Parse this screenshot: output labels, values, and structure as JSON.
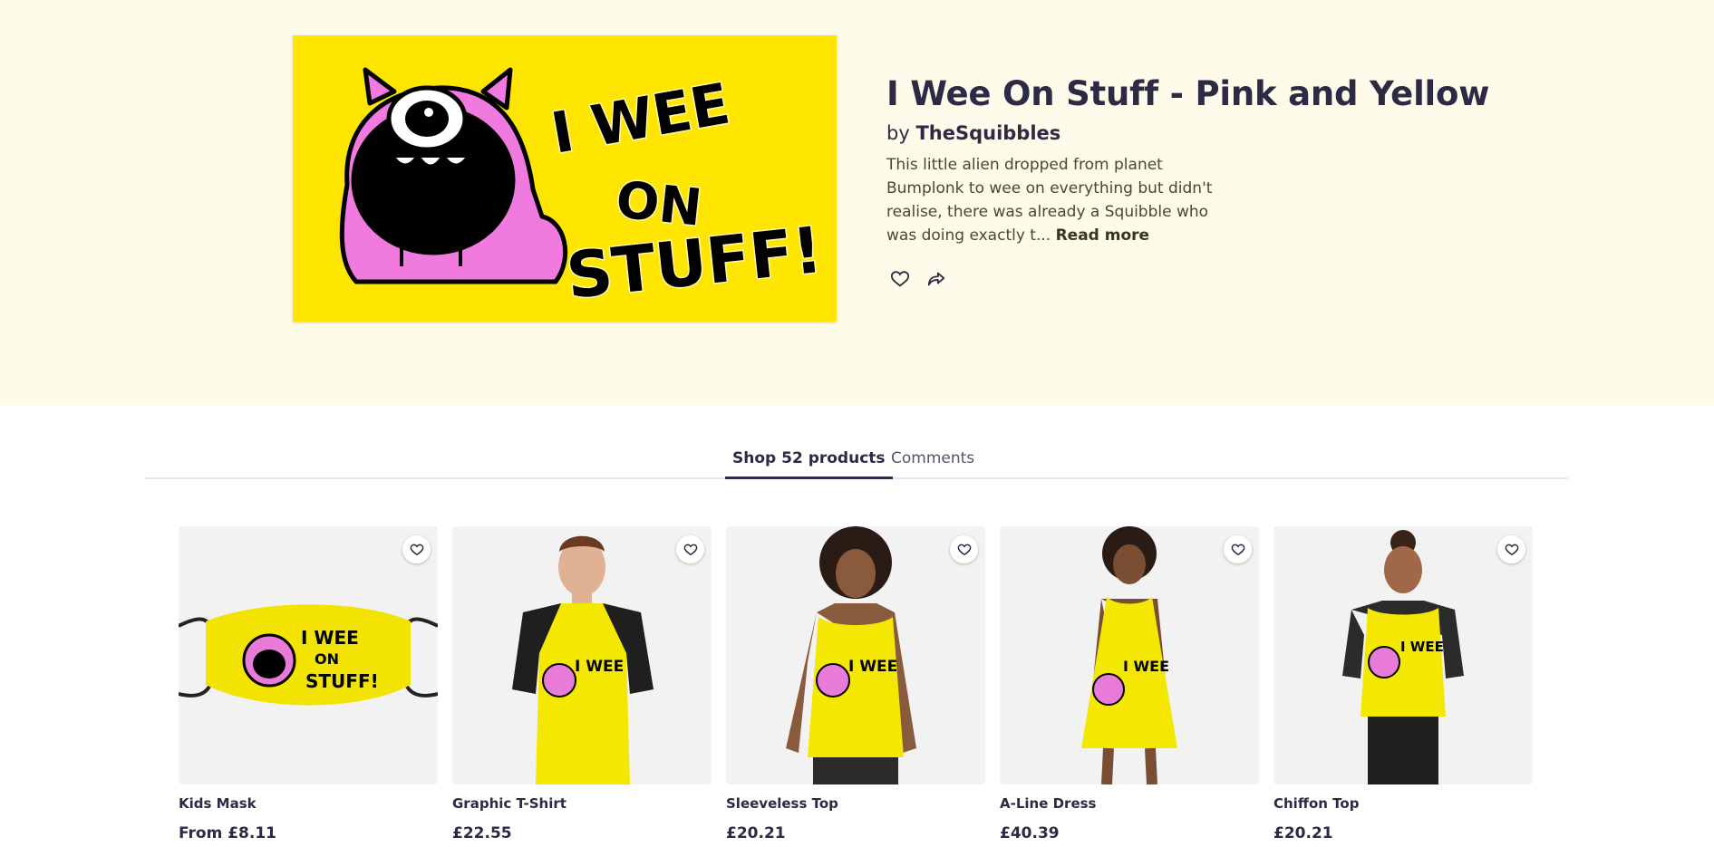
{
  "hero": {
    "title": "I Wee On Stuff - Pink and Yellow",
    "by_prefix": "by",
    "artist": "TheSquibbles",
    "description": "This little alien dropped from planet Bumplonk to wee on everything but didn't realise, there was already a Squibble who was doing exactly t...",
    "read_more": "Read more",
    "art_text": [
      "I WEE",
      "ON",
      "STUFF!"
    ],
    "actions": [
      {
        "icon": "heart-icon"
      },
      {
        "icon": "share-icon"
      }
    ]
  },
  "tabs": [
    {
      "label": "Shop 52 products",
      "active": true
    },
    {
      "label": "Comments",
      "active": false
    }
  ],
  "products": [
    {
      "name": "Kids Mask",
      "price": "From £8.11",
      "type": "mask"
    },
    {
      "name": "Graphic T-Shirt",
      "price": "£22.55",
      "type": "tshirt"
    },
    {
      "name": "Sleeveless Top",
      "price": "£20.21",
      "type": "sleeveless"
    },
    {
      "name": "A-Line Dress",
      "price": "£40.39",
      "type": "dress"
    },
    {
      "name": "Chiffon Top",
      "price": "£20.21",
      "type": "chiffon"
    }
  ],
  "colors": {
    "hero_bg": "#fffbea",
    "art_yellow": "#ffe600",
    "monster_pink": "#f07ae0",
    "text_dark": "#2d2a45"
  }
}
